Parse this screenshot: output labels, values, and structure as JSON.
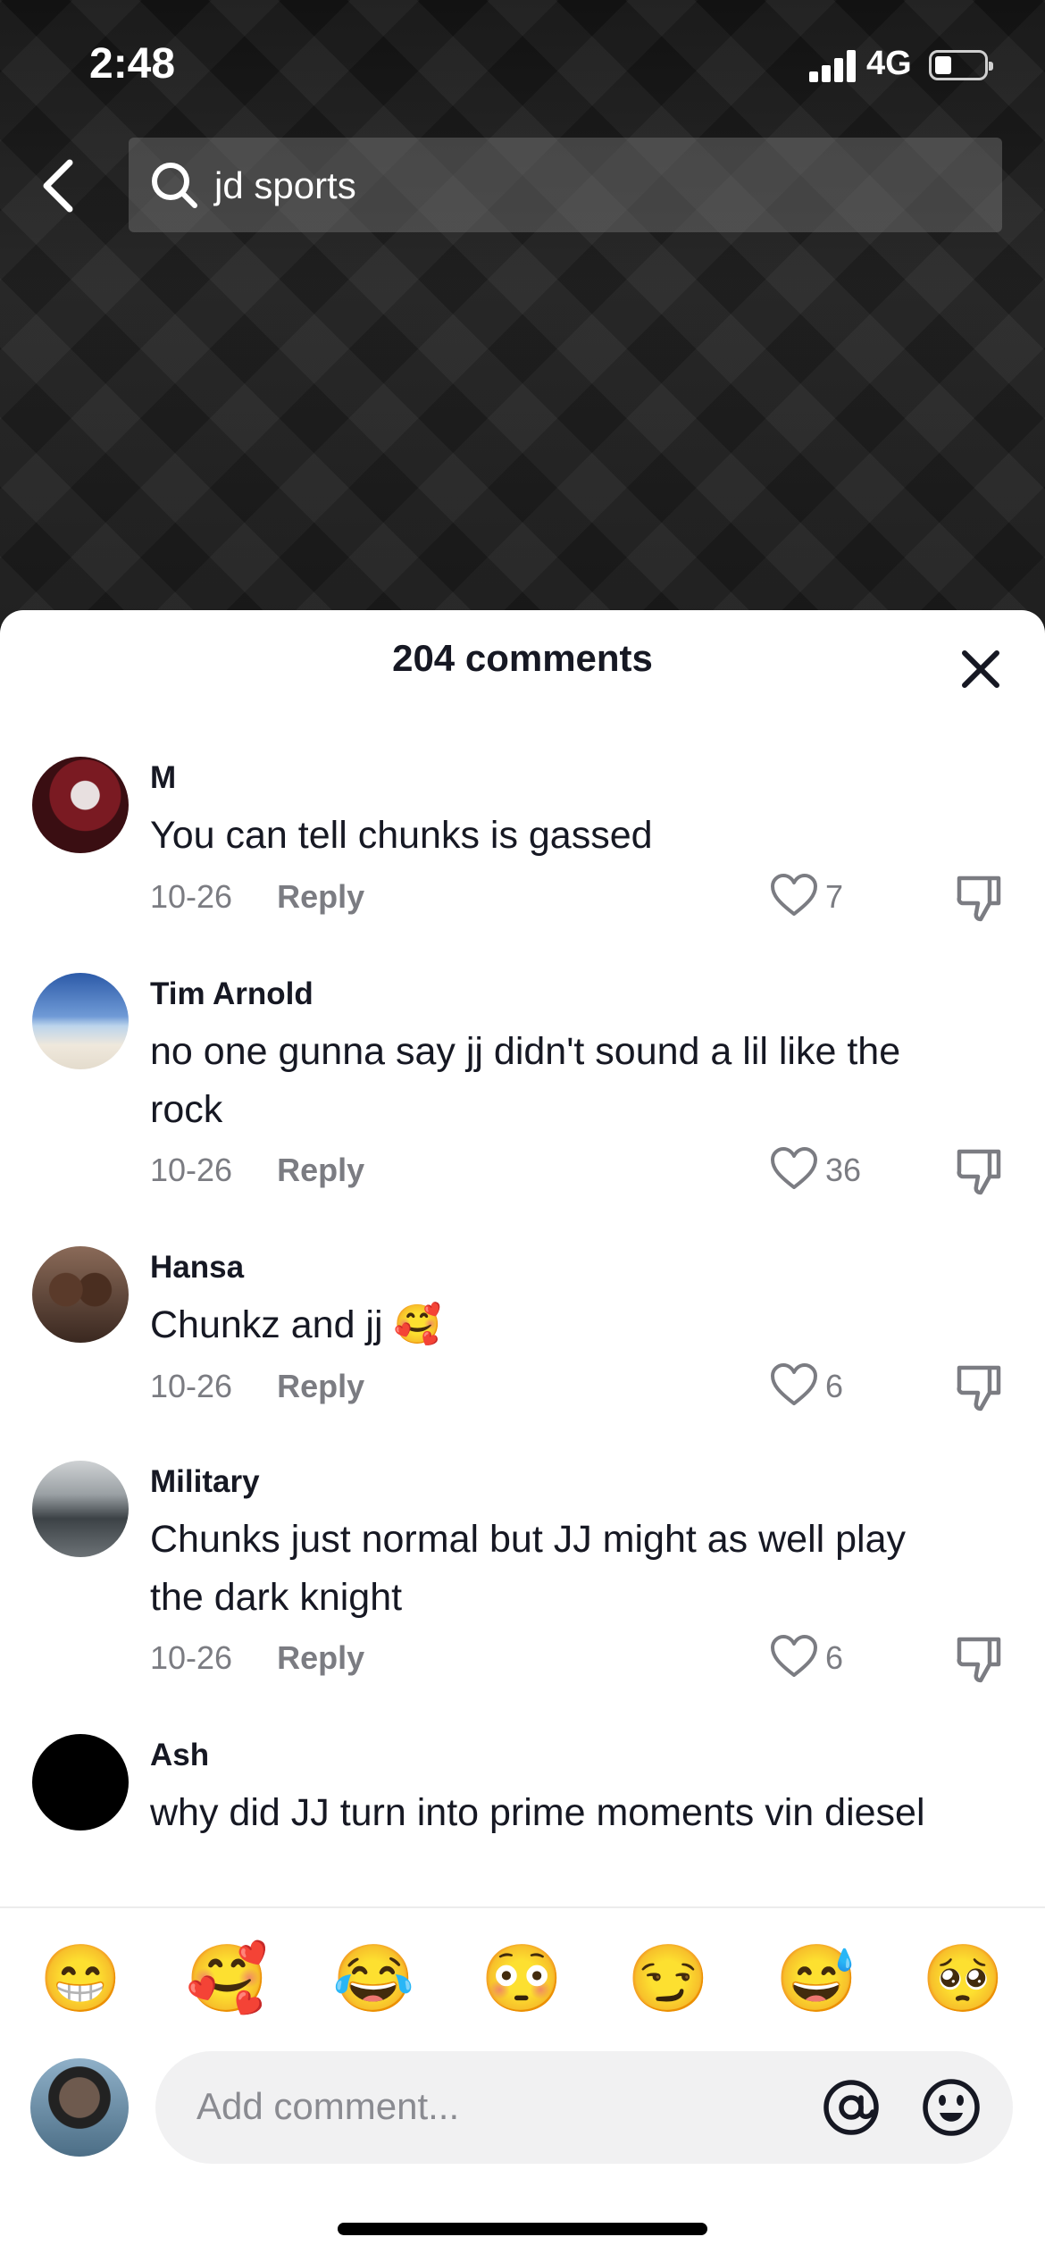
{
  "status_bar": {
    "time": "2:48",
    "network": "4G",
    "battery_icon": "battery-icon"
  },
  "search": {
    "query": "jd sports"
  },
  "comments_sheet": {
    "title": "204 comments",
    "comments": [
      {
        "user": "M",
        "text": "You can tell chunks is gassed",
        "date": "10-26",
        "reply_label": "Reply",
        "likes": "7"
      },
      {
        "user": "Tim Arnold",
        "text": "no one gunna say jj didn't sound a lil like the rock",
        "date": "10-26",
        "reply_label": "Reply",
        "likes": "36"
      },
      {
        "user": "Hansa",
        "text": "Chunkz and jj 🥰",
        "date": "10-26",
        "reply_label": "Reply",
        "likes": "6"
      },
      {
        "user": "Military",
        "text": "Chunks just normal but JJ might as well play the dark knight",
        "date": "10-26",
        "reply_label": "Reply",
        "likes": "6"
      },
      {
        "user": "Ash",
        "text": "why did JJ turn into prime moments vin diesel"
      }
    ]
  },
  "emoji_bar": [
    "😁",
    "🥰",
    "😂",
    "😳",
    "😏",
    "😅",
    "🥺"
  ],
  "composer": {
    "placeholder": "Add comment..."
  },
  "colors": {
    "text_primary": "#161823",
    "text_secondary": "#7b7c82",
    "input_bg": "#f1f1f2"
  }
}
